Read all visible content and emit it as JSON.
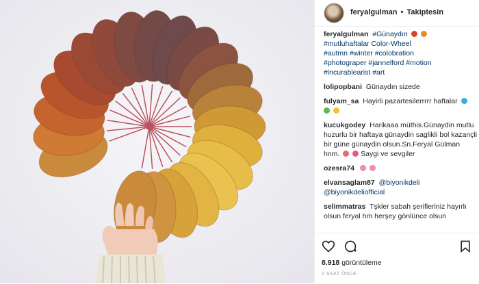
{
  "post": {
    "username": "feryalgulman",
    "separator": "•",
    "follow_label": "Takiptesin"
  },
  "caption": {
    "username": "feryalgulman",
    "lines": [
      "#Günaydın",
      "#mutluhaftalar Color-Wheel",
      "#autmn #winter #colobration",
      "#photograper #jannelford #motion",
      "#incurablearist #art"
    ]
  },
  "comments": [
    {
      "user": "lolipopbani",
      "text": "Günaydın sizede"
    },
    {
      "user": "fulyam_sa",
      "text": "Hayirli pazartesilerrrrr haftalar"
    },
    {
      "user": "kucukgodey",
      "text": "Harikaaa müthis.Günaydin mutlu huzurlu bir haftaya günaydin saglikli bol kazançli bir güne günaydin olsun.Sn.Feryal Gülman hnm.",
      "text2": "Saygi ve sevgiler"
    },
    {
      "user": "ozesra74",
      "text": ""
    },
    {
      "user": "elvansaglam87",
      "text": "@biyonikdeli",
      "text2": "@biyonikdeliofficial"
    },
    {
      "user": "selimmatras",
      "text": "Tşkler sabah şerifleriniz hayırlı olsun feryal hm herşey gönlünce olsun"
    }
  ],
  "stats": {
    "views_count": "8.918",
    "views_label": "görüntüleme",
    "time_ago": "2 SAAT ÖNCE"
  },
  "icons": {
    "like": "heart-icon",
    "comment": "comment-icon",
    "save": "bookmark-icon"
  },
  "colors": {
    "link": "#003569",
    "text": "#262626",
    "muted": "#999999"
  }
}
